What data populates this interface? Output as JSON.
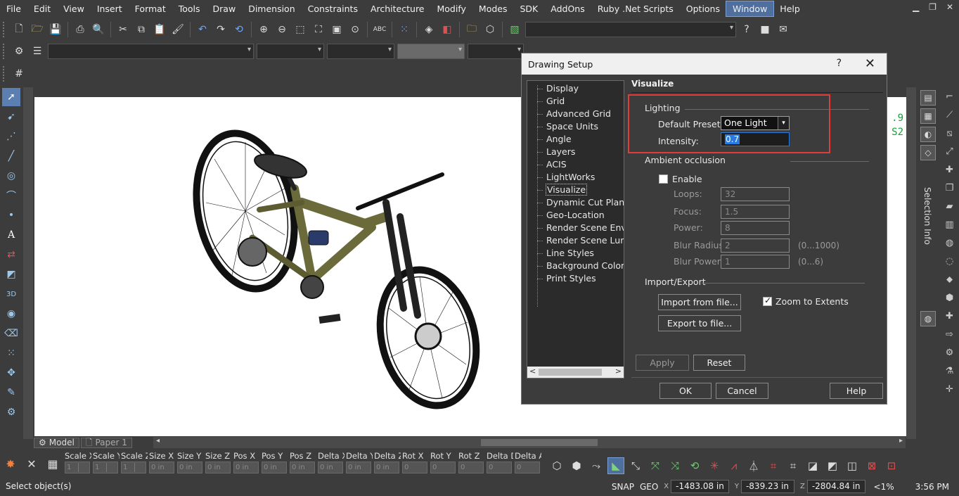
{
  "menubar": {
    "items": [
      "File",
      "Edit",
      "View",
      "Insert",
      "Format",
      "Tools",
      "Draw",
      "Dimension",
      "Constraints",
      "Architecture",
      "Modify",
      "Modes",
      "SDK",
      "AddOns",
      "Ruby .Net Scripts",
      "Options",
      "Window",
      "Help"
    ],
    "active": "Window"
  },
  "canvas": {
    "coord_lines": [
      ".9",
      "S2"
    ]
  },
  "tabs": {
    "model": "Model",
    "paper": "Paper 1"
  },
  "right_panel": {
    "selection_info": "Selection Info"
  },
  "editbar": {
    "fields": [
      {
        "label": "Scale X",
        "value": "1"
      },
      {
        "label": "Scale Y",
        "value": "1"
      },
      {
        "label": "Scale Z",
        "value": "1"
      },
      {
        "label": "Size X",
        "value": "0 in"
      },
      {
        "label": "Size Y",
        "value": "0 in"
      },
      {
        "label": "Size Z",
        "value": "0 in"
      },
      {
        "label": "Pos X",
        "value": "0 in"
      },
      {
        "label": "Pos Y",
        "value": "0 in"
      },
      {
        "label": "Pos Z",
        "value": "0 in"
      },
      {
        "label": "Delta X",
        "value": "0 in"
      },
      {
        "label": "Delta Y",
        "value": "0 in"
      },
      {
        "label": "Delta Z",
        "value": "0 in"
      },
      {
        "label": "Rot X",
        "value": "0"
      },
      {
        "label": "Rot Y",
        "value": "0"
      },
      {
        "label": "Rot Z",
        "value": "0"
      },
      {
        "label": "Delta D",
        "value": "0"
      },
      {
        "label": "Delta A",
        "value": "0"
      }
    ]
  },
  "statusbar": {
    "message": "Select object(s)",
    "snap": "SNAP",
    "geo": "GEO",
    "x": "-1483.08 in",
    "y": "-839.23 in",
    "z": "-2804.84 in",
    "zoom": "<1%",
    "time": "3:56 PM"
  },
  "dialog": {
    "title": "Drawing Setup",
    "help_glyph": "?",
    "close_glyph": "✕",
    "tree": [
      "Display",
      "Grid",
      "Advanced Grid",
      "Space Units",
      "Angle",
      "Layers",
      "ACIS",
      "LightWorks",
      "Visualize",
      "Dynamic Cut Plane",
      "Geo-Location",
      "Render Scene Environment",
      "Render Scene Luminance",
      "Line Styles",
      "Background Color",
      "Print Styles"
    ],
    "tree_selected": "Visualize",
    "section_title": "Visualize",
    "lighting": {
      "title": "Lighting",
      "preset_label": "Default Presets:",
      "preset_value": "One Light",
      "intensity_label": "Intensity:",
      "intensity_value": "0.7"
    },
    "ambient": {
      "title": "Ambient occlusion",
      "enable_label": "Enable",
      "enable_checked": false,
      "loops_label": "Loops:",
      "loops_value": "32",
      "focus_label": "Focus:",
      "focus_value": "1.5",
      "power_label": "Power:",
      "power_value": "8",
      "blur_radius_label": "Blur Radius:",
      "blur_radius_value": "2",
      "blur_radius_range": "(0...1000)",
      "blur_power_label": "Blur Power:",
      "blur_power_value": "1",
      "blur_power_range": "(0...6)"
    },
    "import_export": {
      "title": "Import/Export",
      "import_button": "Import from file...",
      "export_button": "Export to file...",
      "zoom_label": "Zoom to Extents",
      "zoom_checked": true
    },
    "buttons": {
      "apply": "Apply",
      "reset": "Reset",
      "ok": "OK",
      "cancel": "Cancel",
      "help": "Help"
    }
  }
}
